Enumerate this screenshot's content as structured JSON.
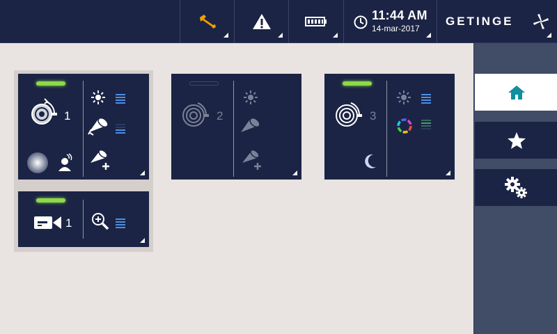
{
  "topbar": {
    "icons": [
      "wrench-icon",
      "warning-icon",
      "battery-icon",
      "clock-icon"
    ],
    "time": "11:44 AM",
    "date": "14-mar-2017",
    "brand": "GETINGE",
    "colors": {
      "bar": "#1b2444",
      "wrench": "#f0a000"
    }
  },
  "sidebar": {
    "items": [
      {
        "name": "home",
        "icon": "home-icon",
        "active": true
      },
      {
        "name": "favorites",
        "icon": "star-icon",
        "active": false
      },
      {
        "name": "settings",
        "icon": "gears-icon",
        "active": false
      }
    ]
  },
  "cards": [
    {
      "label": "1",
      "type": "light",
      "active": true,
      "icons": [
        "light-head-icon",
        "brightness-icon",
        "spotlight-icon",
        "spotlight-plus-icon",
        "ambient-light-icon",
        "surgeon-icon"
      ]
    },
    {
      "label": "2",
      "type": "light",
      "active": false,
      "icons": [
        "light-head-icon",
        "brightness-icon",
        "spotlight-icon",
        "spotlight-plus-icon"
      ]
    },
    {
      "label": "3",
      "type": "light",
      "active": true,
      "icons": [
        "light-head-icon",
        "brightness-icon",
        "color-ring-icon",
        "moon-icon"
      ]
    },
    {
      "label": "1",
      "type": "camera",
      "active": true,
      "icons": [
        "camera-icon",
        "zoom-icon"
      ]
    }
  ],
  "colors": {
    "indicator_on": "#8fd94a",
    "level_blue": "#4a8fe6",
    "accent_teal": "#0f8fa0"
  }
}
